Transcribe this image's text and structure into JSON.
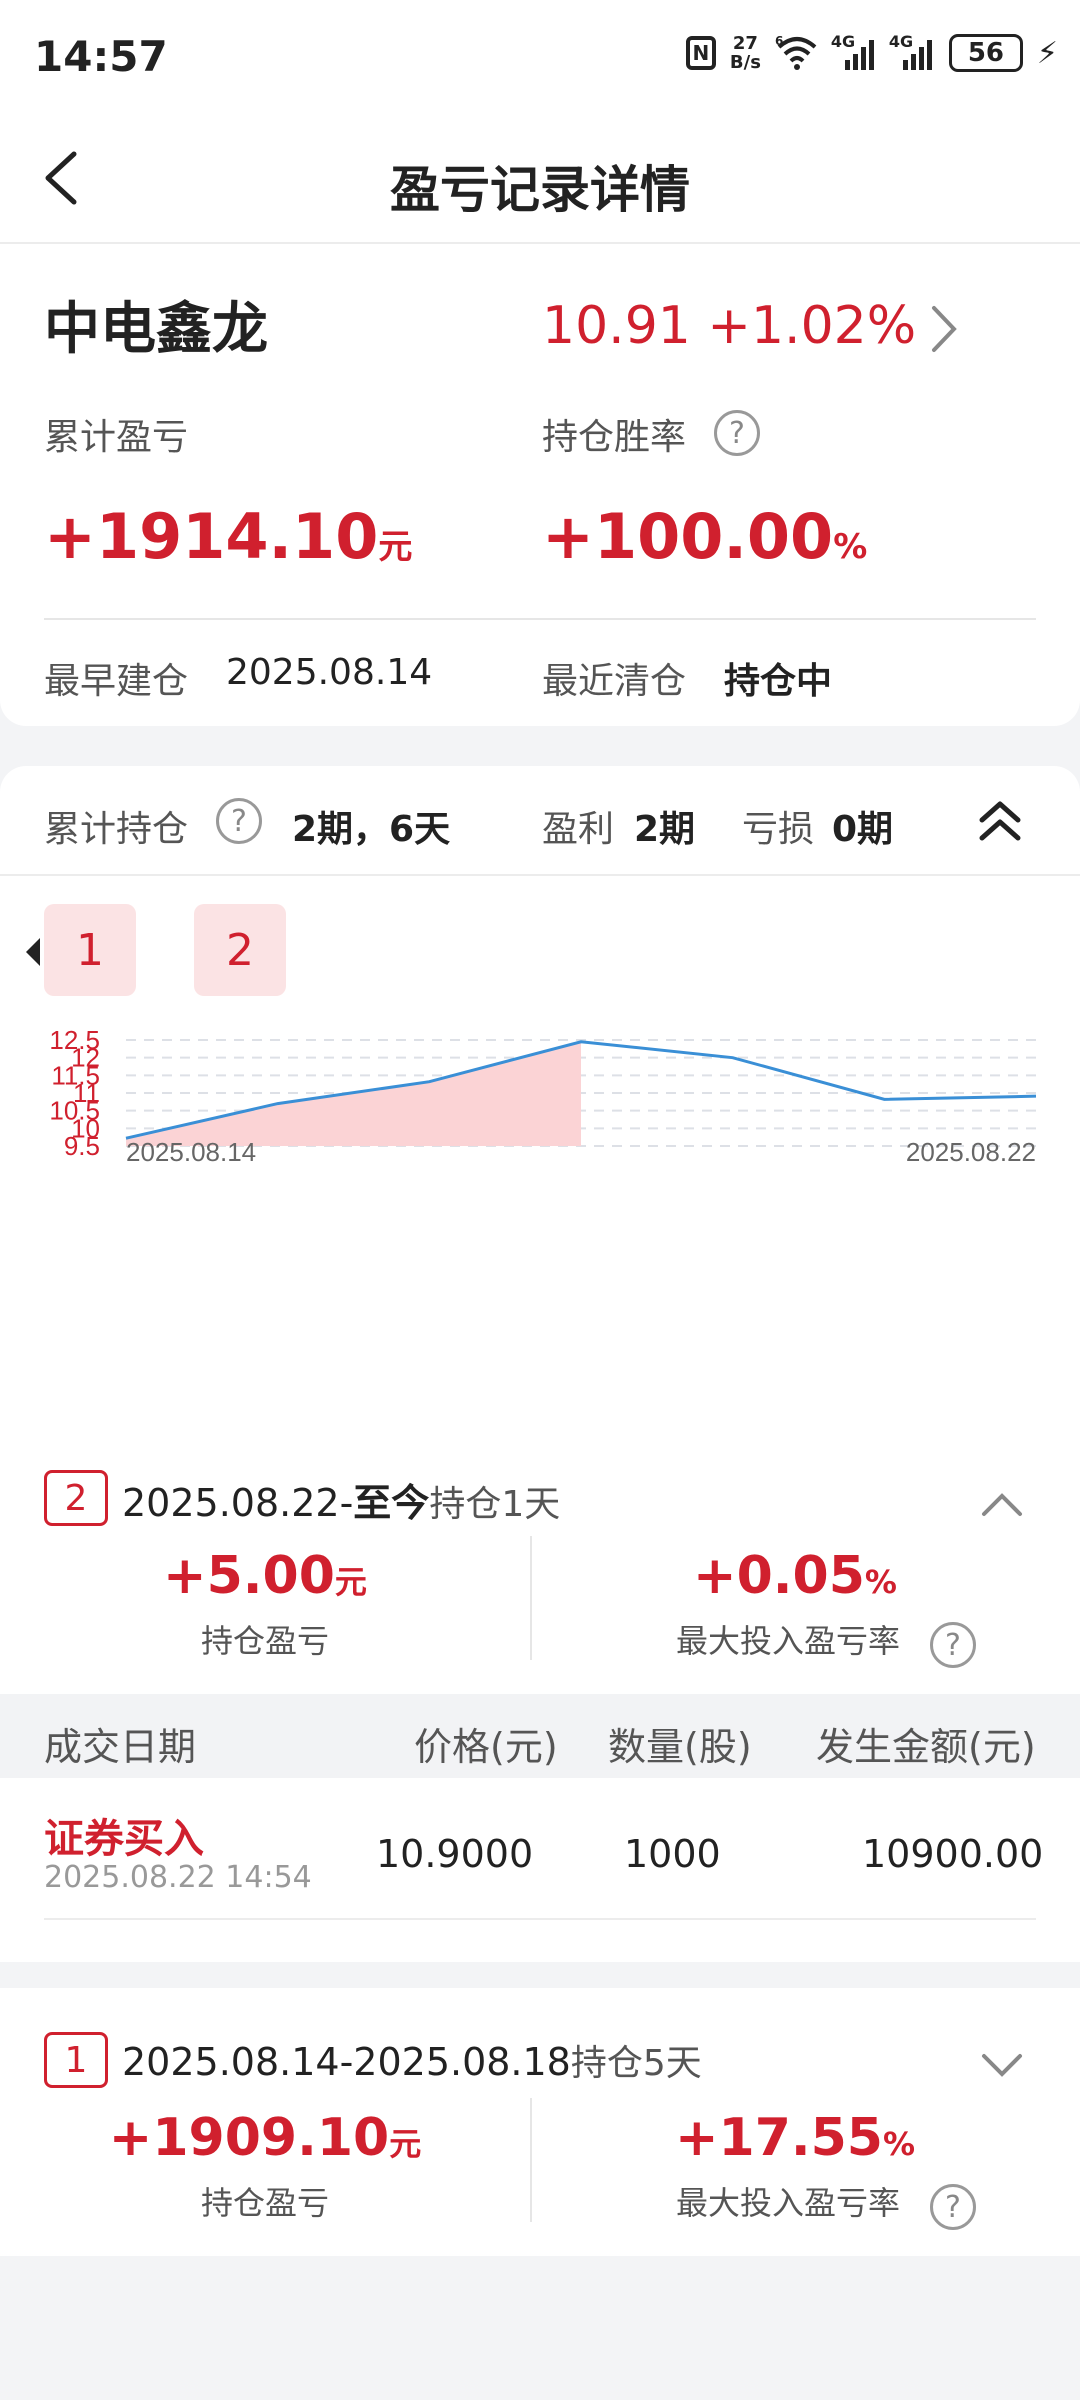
{
  "status": {
    "time": "14:57",
    "speed_top": "27",
    "speed_bottom": "B/s",
    "battery": "56",
    "net1": "4G",
    "net2": "4G",
    "wifi_sup": "6"
  },
  "header": {
    "title": "盈亏记录详情"
  },
  "stock": {
    "name": "中电鑫龙",
    "price_line": "10.91 +1.02%",
    "cum_pnl_label": "累计盈亏",
    "cum_pnl_value": "+1914.10",
    "cum_pnl_unit": "元",
    "win_rate_label": "持仓胜率",
    "win_rate_value": "+100.00",
    "win_rate_unit": "%",
    "first_open_label": "最早建仓",
    "first_open_value": "2025.08.14",
    "last_close_label": "最近清仓",
    "last_close_value": "持仓中"
  },
  "summary": {
    "hold_label": "累计持仓",
    "hold_value": "2期，6天",
    "profit_label": "盈利",
    "profit_value": "2期",
    "loss_label": "亏损",
    "loss_value": "0期"
  },
  "tabs": [
    "1",
    "2"
  ],
  "chart_data": {
    "type": "line",
    "x": [
      "2025.08.14",
      "2025.08.15",
      "2025.08.18",
      "2025.08.19",
      "2025.08.20",
      "2025.08.21",
      "2025.08.22"
    ],
    "values": [
      9.72,
      10.7,
      11.32,
      12.45,
      12.0,
      10.82,
      10.91
    ],
    "yticks": [
      "12.5",
      "12",
      "11.5",
      "11",
      "10.5",
      "10",
      "9.5"
    ],
    "ylim": [
      9.5,
      12.5
    ],
    "x_tick_labels": [
      "2025.08.14",
      "2025.08.22"
    ],
    "shaded_range_index": [
      0,
      3
    ],
    "grid": true,
    "line_color": "#3a8fd6",
    "fill_color": "#fbd3d5"
  },
  "period2": {
    "badge": "2",
    "range_start": "2025.08.22-",
    "range_end": "至今",
    "hold": "持仓1天",
    "pnl_value": "+5.00",
    "pnl_unit": "元",
    "pnl_label": "持仓盈亏",
    "rate_value": "+0.05",
    "rate_unit": "%",
    "rate_label": "最大投入盈亏率"
  },
  "table": {
    "headers": [
      "成交日期",
      "价格(元)",
      "数量(股)",
      "发生金额(元)"
    ],
    "rows": [
      {
        "type": "证券买入",
        "datetime": "2025.08.22 14:54",
        "price": "10.9000",
        "qty": "1000",
        "amount": "10900.00"
      }
    ]
  },
  "period1": {
    "badge": "1",
    "range": "2025.08.14-2025.08.18",
    "hold": "持仓5天",
    "pnl_value": "+1909.10",
    "pnl_unit": "元",
    "pnl_label": "持仓盈亏",
    "rate_value": "+17.55",
    "rate_unit": "%",
    "rate_label": "最大投入盈亏率"
  },
  "colors": {
    "accent_red": "#d0202e",
    "line_blue": "#3a8fd6"
  }
}
